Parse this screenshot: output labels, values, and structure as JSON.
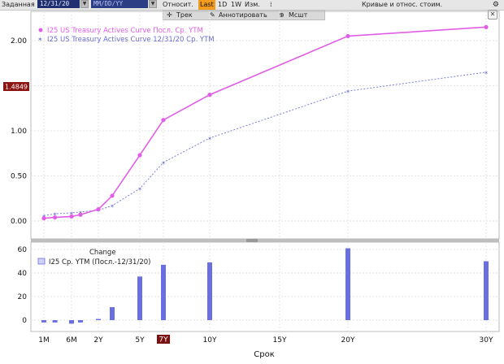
{
  "toolbar": {
    "set_label": "Заданная",
    "start_date": "12/31/20",
    "end_date_placeholder": "MM/DD/YY",
    "relative_label": "Относит.",
    "active_tab": "Last",
    "tab_1d": "1D",
    "tab_1w": "1W",
    "change_label": "Изм.",
    "curves_menu": "Кривые и относ. стоим."
  },
  "subtoolbar": {
    "track_label": "Трек",
    "annotate_label": "Аннотировать",
    "zoom_label": "Мсшт"
  },
  "colors": {
    "current_curve": "#e05ee6",
    "prior_curve": "#7b80d8",
    "change_bars": "#6a6fe0"
  },
  "chart_data": [
    {
      "type": "line",
      "x_ticks": [
        "1M",
        "6M",
        "2Y",
        "5Y",
        "7Y",
        "10Y",
        "15Y",
        "20Y",
        "30Y"
      ],
      "yticks": [
        "0.00",
        "0.50",
        "1.00",
        "1.50",
        "2.00"
      ],
      "ylim": [
        -0.1,
        2.3
      ],
      "y_marker": "1.4849",
      "series": [
        {
          "name": "I25 US Treasury Actives Curve Посл. Ср. YTM",
          "x": [
            "1M",
            "3M",
            "6M",
            "1Y",
            "2Y",
            "3Y",
            "5Y",
            "7Y",
            "10Y",
            "20Y",
            "30Y"
          ],
          "values": [
            0.03,
            0.04,
            0.05,
            0.07,
            0.13,
            0.28,
            0.73,
            1.12,
            1.4,
            2.05,
            2.15
          ]
        },
        {
          "name": "I25 US Treasury Actives Curve 12/31/20 Ср. YTM",
          "x": [
            "1M",
            "3M",
            "6M",
            "1Y",
            "2Y",
            "3Y",
            "5Y",
            "7Y",
            "10Y",
            "20Y",
            "30Y"
          ],
          "values": [
            0.06,
            0.08,
            0.09,
            0.1,
            0.12,
            0.17,
            0.36,
            0.65,
            0.92,
            1.44,
            1.65
          ]
        }
      ]
    },
    {
      "type": "bar",
      "title": "Change",
      "legend": "I25 Ср. YTM (Посл.-12/31/20)",
      "yticks": [
        "0",
        "20",
        "40",
        "60"
      ],
      "ylim": [
        -8,
        68
      ],
      "xlabel": "Срок",
      "x_ticks": [
        "1M",
        "6M",
        "2Y",
        "5Y",
        "7Y",
        "10Y",
        "15Y",
        "20Y",
        "30Y"
      ],
      "highlighted_tick": "7Y",
      "x": [
        "1M",
        "3M",
        "6M",
        "1Y",
        "2Y",
        "3Y",
        "5Y",
        "7Y",
        "10Y",
        "20Y",
        "30Y"
      ],
      "values": [
        -2,
        -2,
        -3,
        -2,
        1,
        11,
        37,
        47,
        49,
        61,
        50
      ]
    }
  ]
}
